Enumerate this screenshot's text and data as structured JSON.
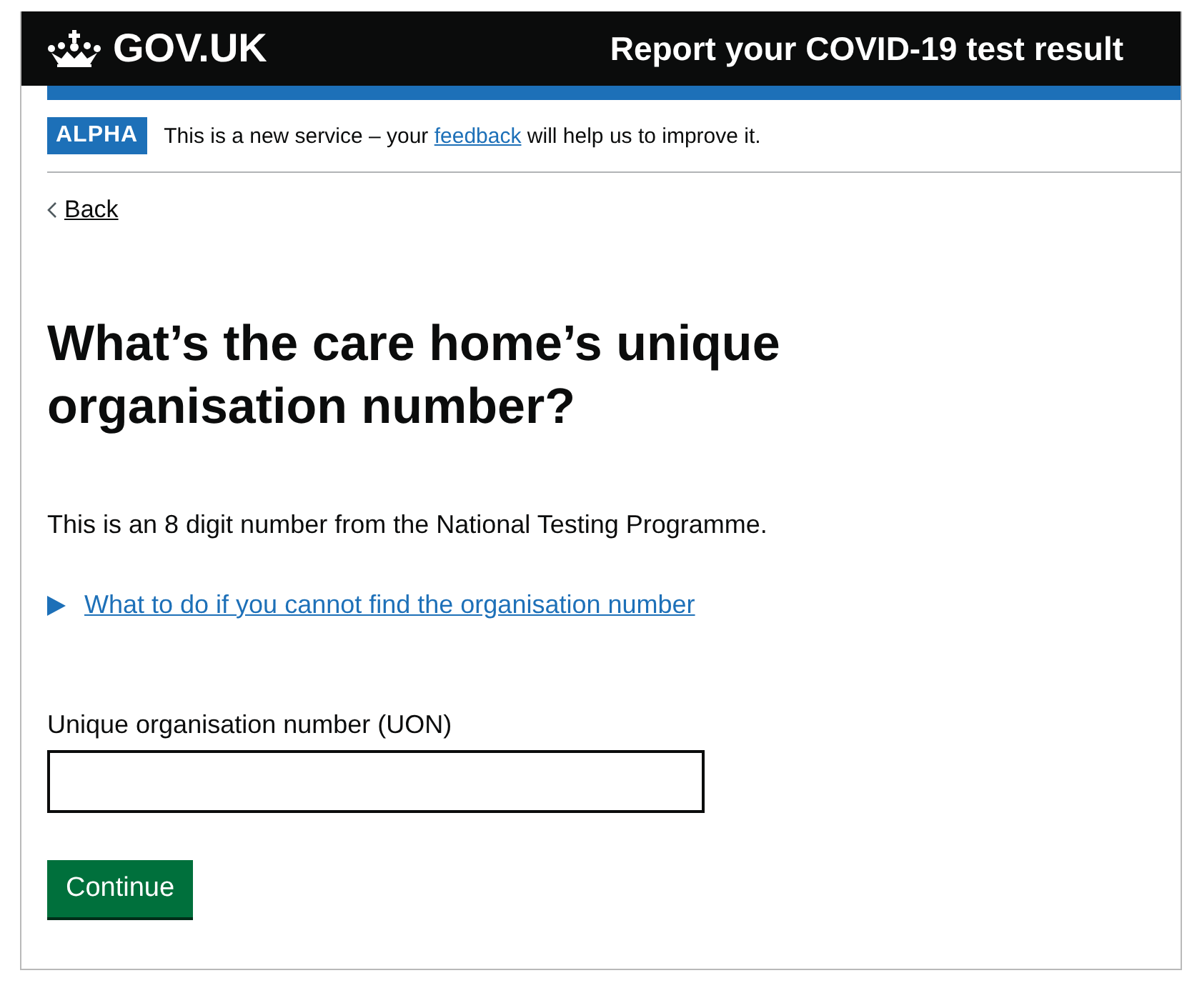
{
  "header": {
    "logo": "GOV.UK",
    "service_name": "Report your COVID-19 test result"
  },
  "phase_banner": {
    "tag": "ALPHA",
    "text_before": "This is a new service – your",
    "link": "feedback",
    "text_after": "will help us to improve it."
  },
  "back_link": "Back",
  "heading": "What’s the care home’s unique organisation number?",
  "hint": "This is an 8 digit number from the National Testing Programme.",
  "details": {
    "summary": "What to do if you cannot find the organisation number",
    "expanded": false
  },
  "field": {
    "label": "Unique organisation number (UON)"
  },
  "button": "Continue"
}
